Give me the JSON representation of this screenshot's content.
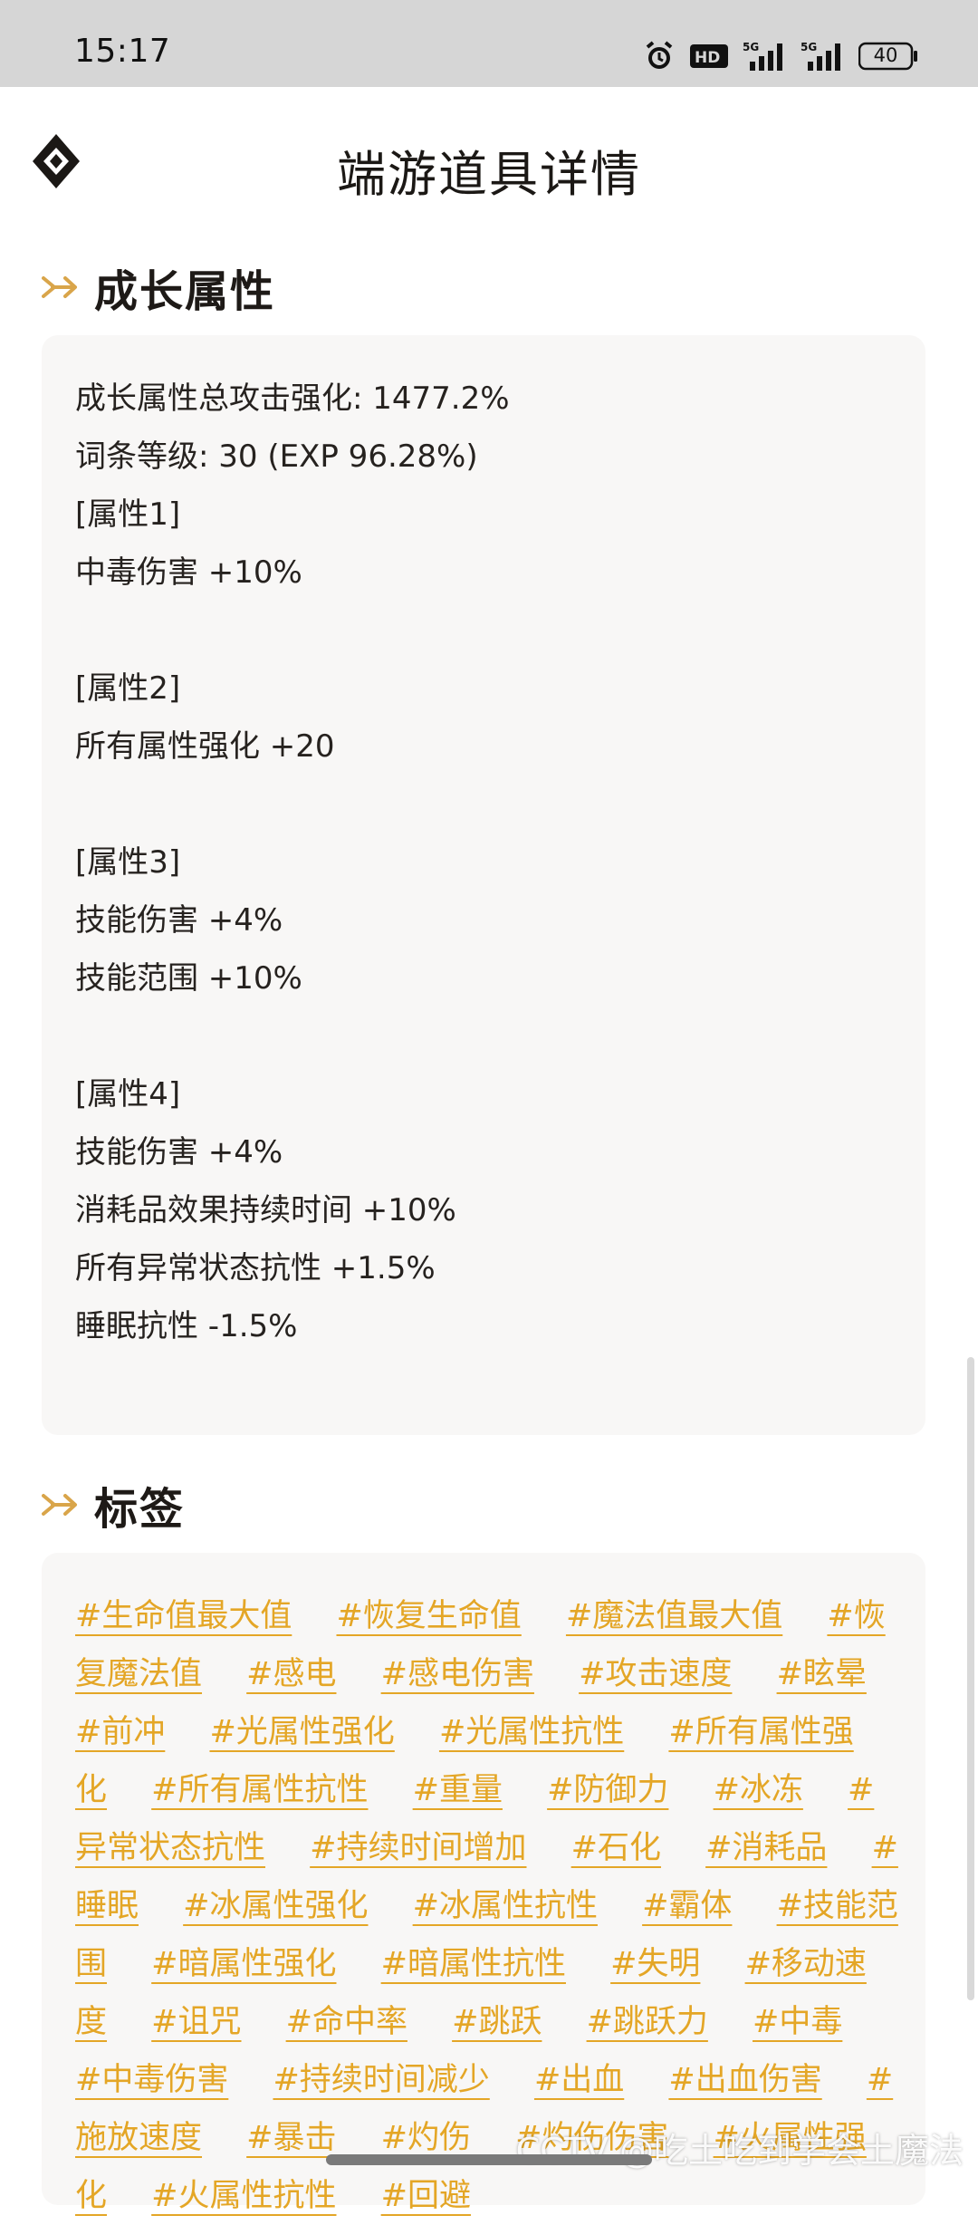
{
  "status_bar": {
    "time": "15:17",
    "battery": "40",
    "icons": [
      "alarm-icon",
      "hd-icon",
      "signal-5g-icon",
      "signal-5g-icon",
      "battery-icon"
    ]
  },
  "header": {
    "title": "端游道具详情",
    "logo_icon": "diamond-logo-icon"
  },
  "growth_section": {
    "title": "成长属性",
    "lines": [
      "成长属性总攻击强化: 1477.2%",
      "词条等级: 30 (EXP 96.28%)",
      "[属性1]",
      "中毒伤害 +10%",
      "",
      "[属性2]",
      "所有属性强化 +20",
      "",
      "[属性3]",
      "技能伤害 +4%",
      "技能范围 +10%",
      "",
      "[属性4]",
      "技能伤害 +4%",
      "消耗品效果持续时间 +10%",
      "所有异常状态抗性 +1.5%",
      "睡眠抗性 -1.5%"
    ]
  },
  "tags_section": {
    "title": "标签",
    "tags": [
      "#生命值最大值",
      "#恢复生命值",
      "#魔法值最大值",
      "#恢复魔法值",
      "#感电",
      "#感电伤害",
      "#攻击速度",
      "#眩晕",
      "#前冲",
      "#光属性强化",
      "#光属性抗性",
      "#所有属性强化",
      "#所有属性抗性",
      "#重量",
      "#防御力",
      "#冰冻",
      "#异常状态抗性",
      "#持续时间增加",
      "#石化",
      "#消耗品",
      "#睡眠",
      "#冰属性强化",
      "#冰属性抗性",
      "#霸体",
      "#技能范围",
      "#暗属性强化",
      "#暗属性抗性",
      "#失明",
      "#移动速度",
      "#诅咒",
      "#命中率",
      "#跳跃",
      "#跳跃力",
      "#中毒",
      "#中毒伤害",
      "#持续时间减少",
      "#出血",
      "#出血伤害",
      "#施放速度",
      "#暴击",
      "#灼伤",
      "#灼伤伤害",
      "#火属性强化",
      "#火属性抗性",
      "#回避"
    ]
  },
  "watermark": "CCTV @吃土吃到学会土魔法",
  "colors": {
    "tag": "#e4a626",
    "accent_arrow": "#d9a54a",
    "panel_bg": "#f8f7f6",
    "status_bg": "#d6d6d6"
  }
}
